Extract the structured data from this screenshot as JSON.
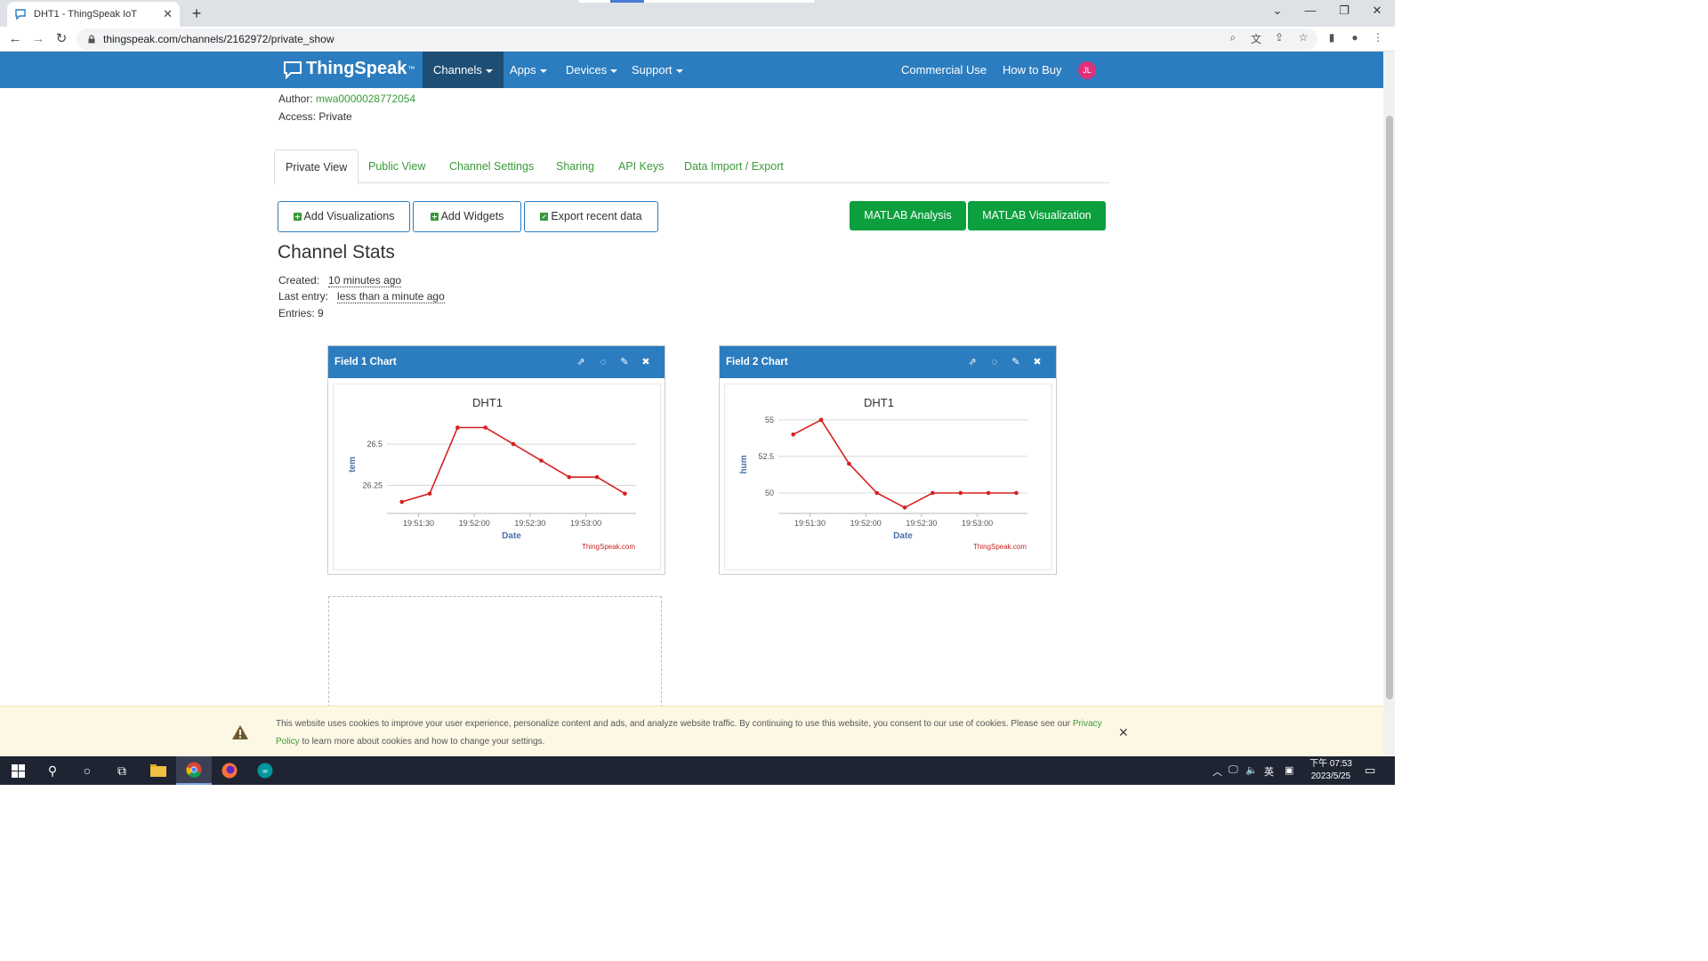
{
  "browser": {
    "tab_title": "DHT1 - ThingSpeak IoT",
    "url": "thingspeak.com/channels/2162972/private_show"
  },
  "nav": {
    "brand": "ThingSpeak",
    "brand_tm": "™",
    "items": [
      "Channels",
      "Apps",
      "Devices",
      "Support"
    ],
    "right_items": [
      "Commercial Use",
      "How to Buy"
    ],
    "avatar_initials": "JL"
  },
  "channel": {
    "author_label": "Author:",
    "author": "mwa0000028772054",
    "access_label": "Access:",
    "access": "Private"
  },
  "tabs": [
    "Private View",
    "Public View",
    "Channel Settings",
    "Sharing",
    "API Keys",
    "Data Import / Export"
  ],
  "buttons": {
    "add_visualizations": "Add Visualizations",
    "add_widgets": "Add Widgets",
    "export_recent": "Export recent data",
    "matlab_analysis": "MATLAB Analysis",
    "matlab_visualization": "MATLAB Visualization"
  },
  "stats": {
    "title": "Channel Stats",
    "created_label": "Created:",
    "created": "10 minutes ago",
    "last_entry_label": "Last entry:",
    "last_entry": "less than a minute ago",
    "entries_label": "Entries:",
    "entries": "9"
  },
  "charts": [
    {
      "panel_title": "Field 1 Chart"
    },
    {
      "panel_title": "Field 2 Chart"
    }
  ],
  "chart_data": [
    {
      "type": "line",
      "title": "DHT1",
      "xlabel": "Date",
      "ylabel": "tem",
      "credit": "ThingSpeak.com",
      "x_ticks": [
        "19:51:30",
        "19:52:00",
        "19:52:30",
        "19:53:00"
      ],
      "y_ticks": [
        26.25,
        26.5
      ],
      "ylim": [
        26.08,
        26.7
      ],
      "x": [
        "19:51:21",
        "19:51:36",
        "19:51:51",
        "19:52:06",
        "19:52:21",
        "19:52:36",
        "19:52:51",
        "19:53:06",
        "19:53:21"
      ],
      "series": [
        {
          "values": [
            26.15,
            26.2,
            26.6,
            26.6,
            26.5,
            26.4,
            26.3,
            26.3,
            26.2
          ],
          "color": "#d62020"
        }
      ]
    },
    {
      "type": "line",
      "title": "DHT1",
      "xlabel": "Date",
      "ylabel": "hum",
      "credit": "ThingSpeak.com",
      "x_ticks": [
        "19:51:30",
        "19:52:00",
        "19:52:30",
        "19:53:00"
      ],
      "y_ticks": [
        50,
        52.5,
        55
      ],
      "ylim": [
        48.6,
        55.6
      ],
      "x": [
        "19:51:21",
        "19:51:36",
        "19:51:51",
        "19:52:06",
        "19:52:21",
        "19:52:36",
        "19:52:51",
        "19:53:06",
        "19:53:21"
      ],
      "series": [
        {
          "values": [
            54,
            55,
            52,
            50,
            49,
            50,
            50,
            50,
            50
          ],
          "color": "#d62020"
        }
      ]
    }
  ],
  "cookie": {
    "text": "This website uses cookies to improve your user experience, personalize content and ads, and analyze website traffic. By continuing to use this website, you consent to our use of cookies. Please see our ",
    "link": "Privacy Policy",
    "text_after": " to learn more about cookies and how to change your settings."
  },
  "taskbar": {
    "time": "下午 07:53",
    "date": "2023/5/25",
    "ime": "英"
  },
  "colors": {
    "nav": "#2c7dbf",
    "nav_active": "#1e4e74",
    "link_green": "#389a39",
    "button_green": "#0c9f3d",
    "series_red": "#d62020"
  }
}
